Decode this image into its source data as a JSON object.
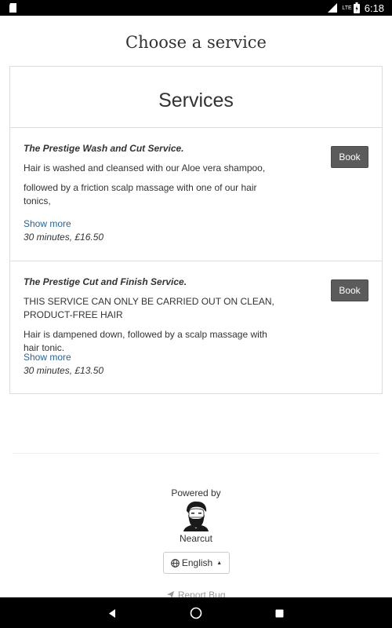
{
  "status_bar": {
    "network_label": "LTE",
    "time": "6:18"
  },
  "page": {
    "title": "Choose a service"
  },
  "services_card": {
    "heading": "Services",
    "items": [
      {
        "title": "The Prestige Wash and Cut Service.",
        "description": [
          "Hair is washed and cleansed with our Aloe vera shampoo,",
          "followed by a friction scalp massage with one of our hair tonics,"
        ],
        "show_more_label": "Show more",
        "meta": "30 minutes, £16.50",
        "book_label": "Book"
      },
      {
        "title": "The Prestige Cut and Finish Service.",
        "description": [
          "THIS SERVICE CAN ONLY BE CARRIED OUT ON CLEAN, PRODUCT-FREE HAIR",
          "Hair is dampened down, followed by a scalp massage with hair tonic."
        ],
        "show_more_label": "Show more",
        "meta": "30 minutes, £13.50",
        "book_label": "Book"
      }
    ]
  },
  "footer": {
    "powered_by": "Powered by",
    "brand": "Nearcut",
    "language_label": "English",
    "report_bug_label": "Report Bug"
  },
  "icons": {
    "status_left": "sd-card-icon",
    "battery": "battery-icon",
    "signal": "signal-icon",
    "language": "globe-icon",
    "nav_back": "back-triangle-icon",
    "nav_home": "home-circle-icon",
    "nav_recents": "recents-square-icon"
  },
  "colors": {
    "book_button": "#5b5b5b",
    "link": "#2a6496",
    "status_bar": "#000000"
  }
}
